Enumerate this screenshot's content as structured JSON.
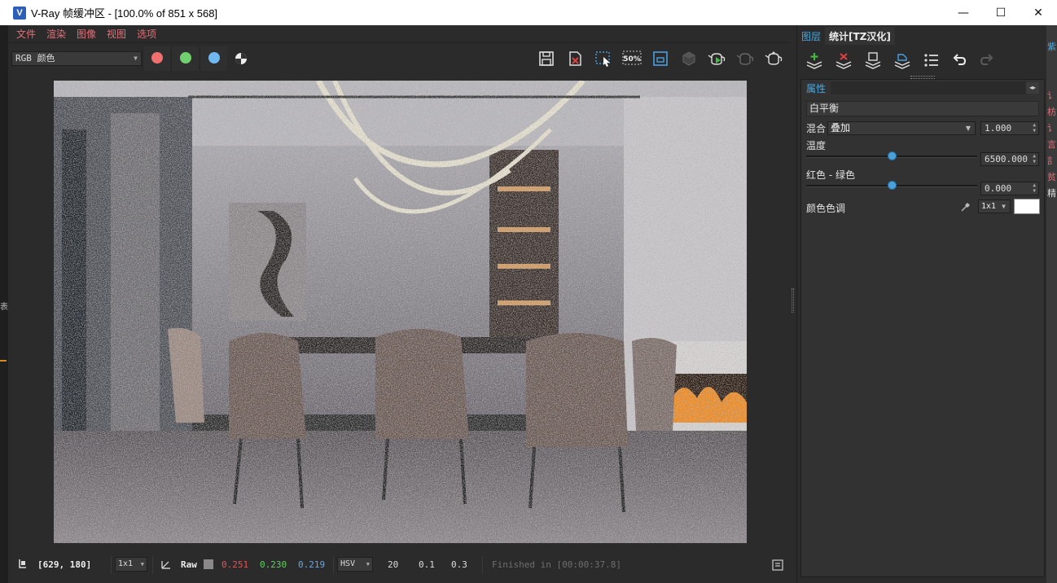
{
  "window": {
    "title": "V-Ray 帧缓冲区 - [100.0% of 851 x 568]",
    "icon_letter": "V",
    "controls": {
      "minimize": "—",
      "maximize": "☐",
      "close": "✕"
    }
  },
  "menu": [
    "文件",
    "渲染",
    "图像",
    "视图",
    "选项"
  ],
  "toolbar": {
    "channel_value": "RGB 颜色",
    "channel_colors": {
      "red": "#f07070",
      "green": "#70d070",
      "blue": "#70b8f0"
    },
    "tools": [
      "save-icon",
      "clear-icon",
      "region-render-icon",
      "zoom-50-icon",
      "render-region-icon",
      "cube-icon",
      "render-teapot-icon",
      "interactive-teapot-icon",
      "teapot-icon"
    ],
    "zoom_label": "50%"
  },
  "status": {
    "coords": "[629, 180]",
    "sample_size": "1x1",
    "raw_label": "Raw",
    "r": "0.251",
    "g": "0.230",
    "b": "0.219",
    "color_mode": "HSV",
    "h": "20",
    "s": "0.1",
    "v": "0.3",
    "message": "Finished in [00:00:37.8]"
  },
  "panel": {
    "tabs": [
      "图层",
      "统计[TZ汉化]"
    ],
    "tools": [
      "add-layer-icon",
      "delete-layer-icon",
      "save-layers-icon",
      "load-layers-icon",
      "list-icon",
      "undo-icon",
      "redo-icon"
    ],
    "props_title": "属性",
    "layer_name": "白平衡",
    "blend_label": "混合",
    "blend_mode": "叠加",
    "blend_value": "1.000",
    "temperature_label": "温度",
    "temperature_value": "6500.000",
    "temperature_level": 0.5,
    "tint_label": "红色 - 绿色",
    "tint_value": "0.000",
    "tint_level": 0.5,
    "color_tint_label": "颜色色调",
    "color_tint_sample": "1x1",
    "color_tint_color": "#ffffff"
  },
  "left_edge_label": "表",
  "right_edge_chars": [
    "紫",
    "讠",
    "枋",
    "讠",
    "言",
    "訁",
    "贫",
    "精"
  ]
}
